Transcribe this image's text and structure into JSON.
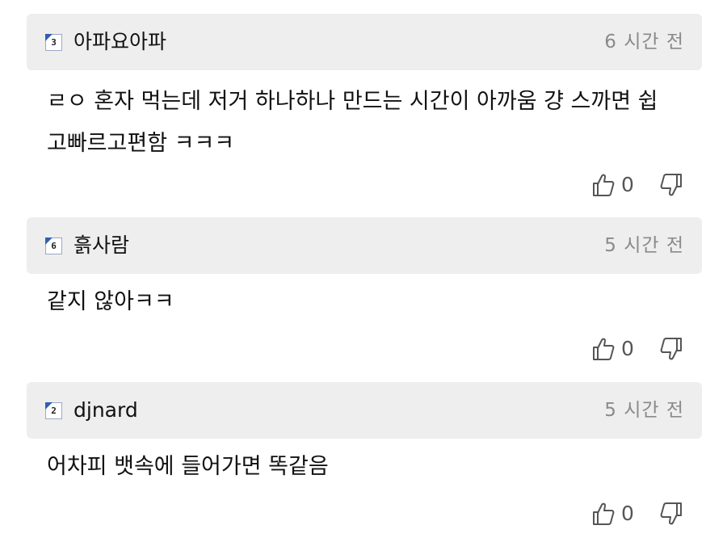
{
  "comments": [
    {
      "nickname": "아파요아파",
      "level": "3",
      "time": "6 시간 전",
      "body_lines": [
        "ㄹㅇ 혼자 먹는데 저거 하나하나 만드는 시간이 아까움 걍 스까면 쉽",
        "고빠르고편함 ㅋㅋㅋ"
      ],
      "likes": "0"
    },
    {
      "nickname": "흙사람",
      "level": "6",
      "time": "5 시간 전",
      "body_lines": [
        "같지 않아ㅋㅋ"
      ],
      "likes": "0"
    },
    {
      "nickname": "djnard",
      "level": "2",
      "time": "5 시간 전",
      "body_lines": [
        "어차피 뱃속에 들어가면 똑같음"
      ],
      "likes": "0"
    }
  ],
  "icons": {
    "like": "thumbs-up-icon",
    "dislike": "thumbs-down-icon",
    "level": "level-badge-icon"
  },
  "colors": {
    "header_bg": "#eeeeee",
    "time": "#8a8a8a",
    "badge_accent": "#2f5fb4"
  }
}
